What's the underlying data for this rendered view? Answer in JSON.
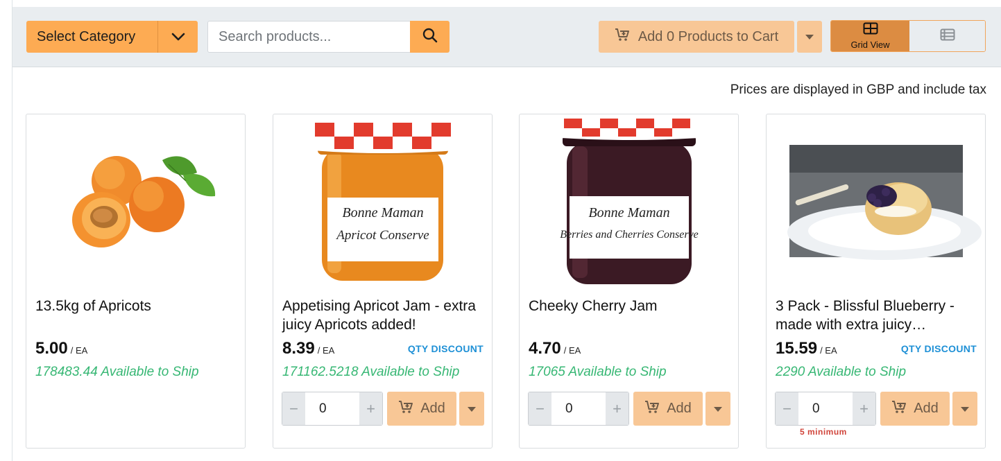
{
  "toolbar": {
    "category_label": "Select Category",
    "search_placeholder": "Search products...",
    "cart_label": "Add 0 Products to Cart",
    "grid_view_label": "Grid View"
  },
  "price_note": "Prices are displayed in GBP and include tax",
  "products": [
    {
      "name": "13.5kg of Apricots",
      "price": "5.00",
      "unit": "/ EA",
      "qty_discount": "",
      "available": "178483.44 Available to Ship",
      "image": "apricots-image",
      "has_controls": false
    },
    {
      "name": "Appetising Apricot Jam - extra juicy Apricots added!",
      "price": "8.39",
      "unit": "/ EA",
      "qty_discount": "QTY DISCOUNT",
      "available": "171162.5218 Available to Ship",
      "image": "apricot-jam-image",
      "has_controls": true,
      "qty": "0",
      "add_label": "Add"
    },
    {
      "name": "Cheeky Cherry Jam",
      "price": "4.70",
      "unit": "/ EA",
      "qty_discount": "",
      "available": "17065 Available to Ship",
      "image": "cherry-jam-image",
      "has_controls": true,
      "qty": "0",
      "add_label": "Add"
    },
    {
      "name": "3 Pack - Blissful Blueberry - made with extra juicy…",
      "price": "15.59",
      "unit": "/ EA",
      "qty_discount": "QTY DISCOUNT",
      "available": "2290 Available to Ship",
      "image": "blueberry-scone-image",
      "has_controls": true,
      "qty": "0",
      "add_label": "Add",
      "minimum_note": "5 minimum"
    }
  ],
  "colors": {
    "accent": "#fdab53",
    "accent_light": "#f8c796",
    "active_view": "#dc8c42",
    "available_green": "#37b774",
    "discount_blue": "#1e90d6",
    "minimum_red": "#d0443a"
  }
}
